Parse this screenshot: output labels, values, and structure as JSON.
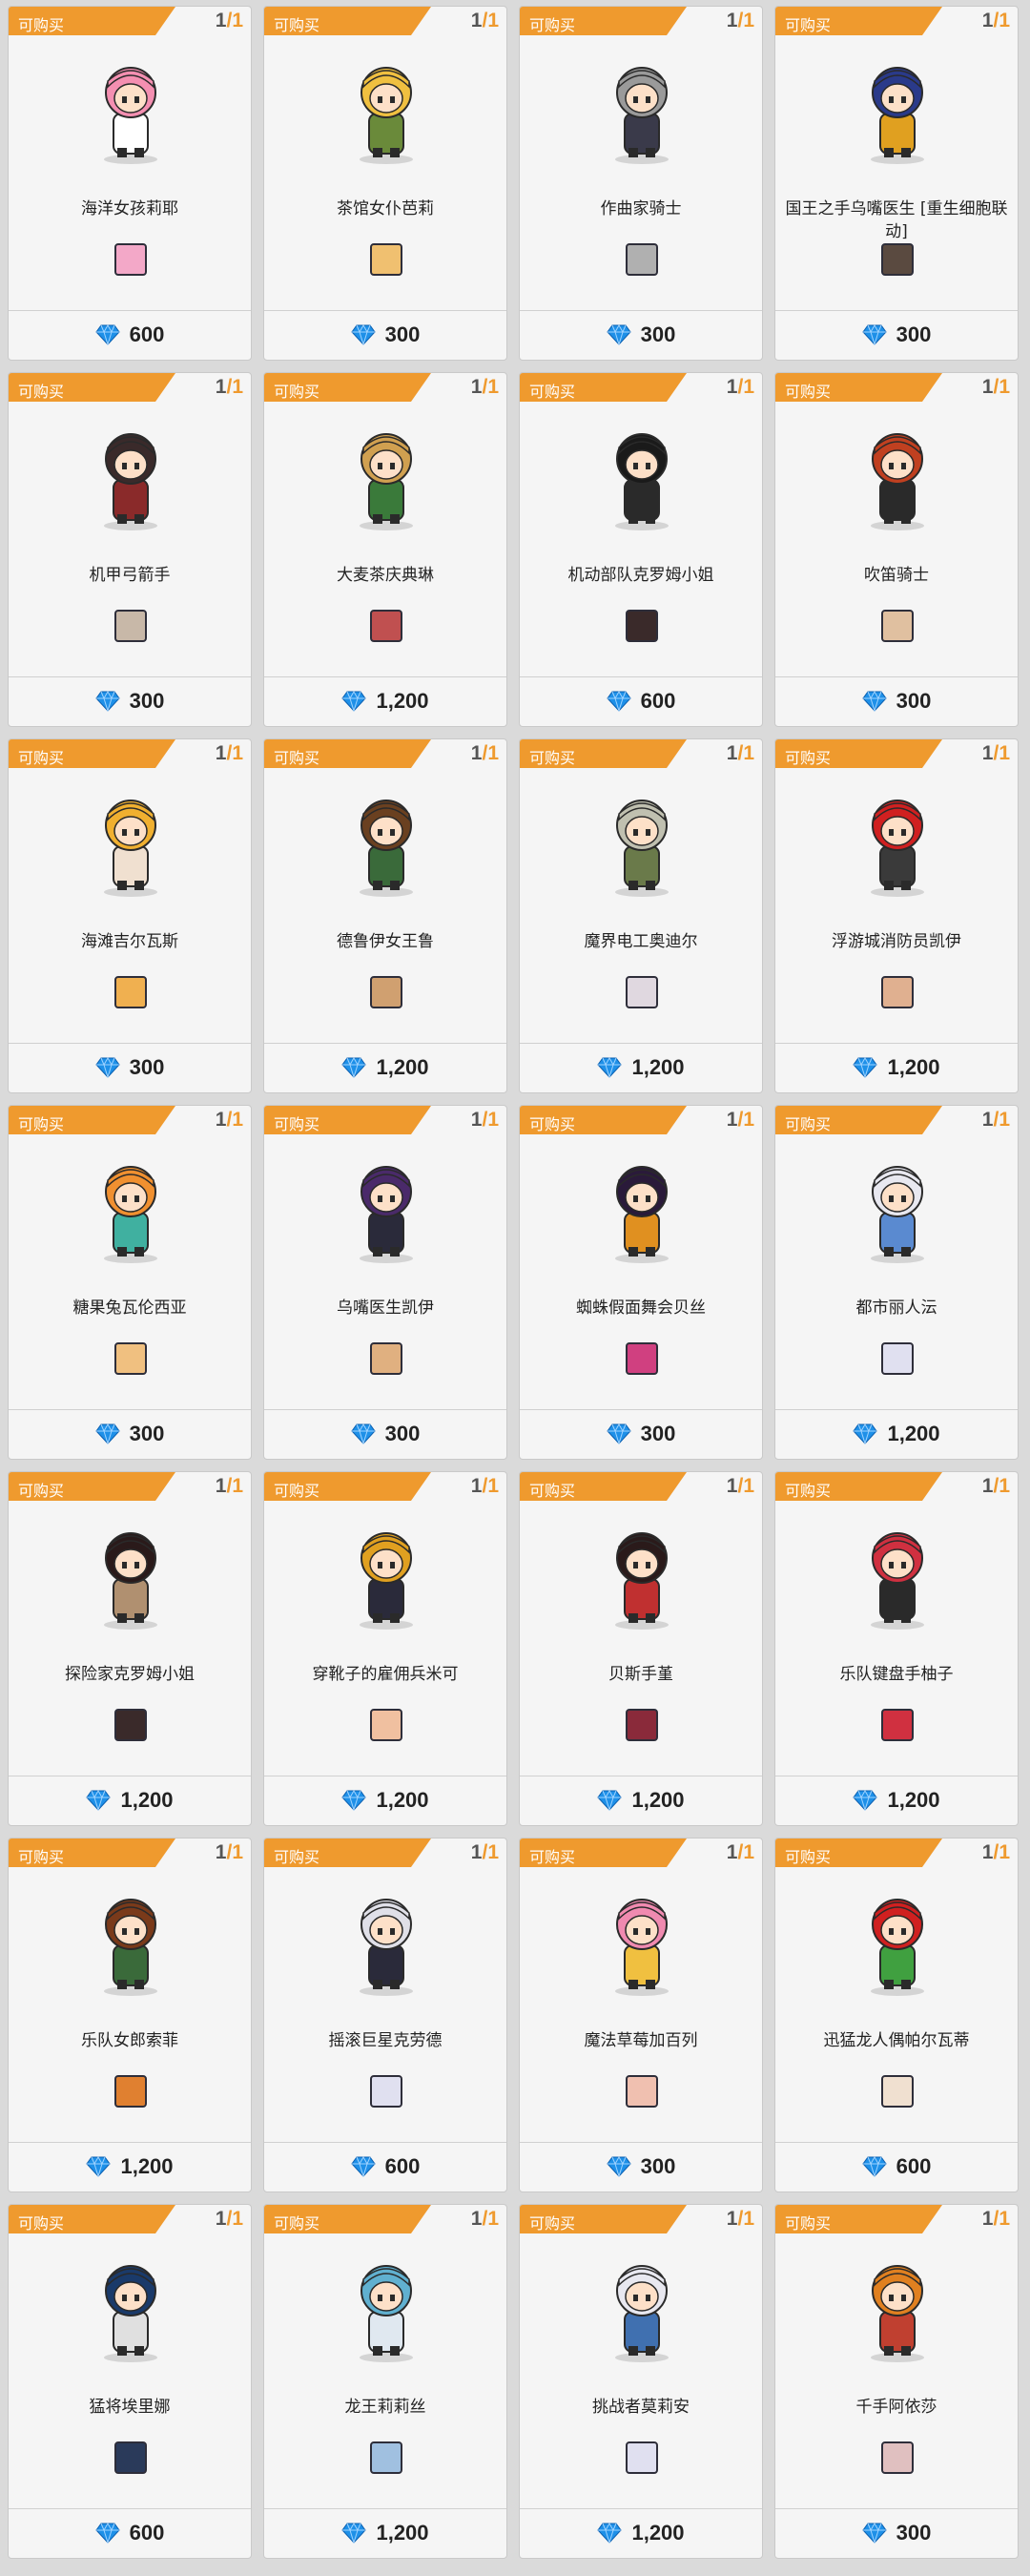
{
  "labels": {
    "badge": "可购买"
  },
  "colors": {
    "badge_bg": "#ef9a2e",
    "count_max": "#ef9a2e",
    "currency_gem": "#1e90e8"
  },
  "currency_icon": "blue-diamond-icon",
  "items": [
    {
      "name": "海洋女孩莉耶",
      "owned": "1",
      "limit": "1",
      "price": "600",
      "hair": "#f48fb1",
      "outfit": "#ffffff",
      "thumb": "#f3a8c8"
    },
    {
      "name": "茶馆女仆芭莉",
      "owned": "1",
      "limit": "1",
      "price": "300",
      "hair": "#f0c040",
      "outfit": "#6a8a3a",
      "thumb": "#f0c070"
    },
    {
      "name": "作曲家骑士",
      "owned": "1",
      "limit": "1",
      "price": "300",
      "hair": "#9a9a9a",
      "outfit": "#3a3a4a",
      "thumb": "#b0b0b0"
    },
    {
      "name": "国王之手乌嘴医生 [重生细胞联动]",
      "owned": "1",
      "limit": "1",
      "price": "300",
      "hair": "#2a3a8a",
      "outfit": "#e0a020",
      "thumb": "#5a4a40"
    },
    {
      "name": "机甲弓箭手",
      "owned": "1",
      "limit": "1",
      "price": "300",
      "hair": "#3a2a2a",
      "outfit": "#8a2a2a",
      "thumb": "#c8b8a8"
    },
    {
      "name": "大麦茶庆典琳",
      "owned": "1",
      "limit": "1",
      "price": "1,200",
      "hair": "#d0a050",
      "outfit": "#3a7a3a",
      "thumb": "#c05050"
    },
    {
      "name": "机动部队克罗姆小姐",
      "owned": "1",
      "limit": "1",
      "price": "600",
      "hair": "#1a1a1a",
      "outfit": "#2a2a2a",
      "thumb": "#3a2a2a"
    },
    {
      "name": "吹笛骑士",
      "owned": "1",
      "limit": "1",
      "price": "300",
      "hair": "#c04020",
      "outfit": "#2a2a2a",
      "thumb": "#e0c0a0"
    },
    {
      "name": "海滩吉尔瓦斯",
      "owned": "1",
      "limit": "1",
      "price": "300",
      "hair": "#f0b030",
      "outfit": "#f0e0d0",
      "thumb": "#f0b050"
    },
    {
      "name": "德鲁伊女王鲁",
      "owned": "1",
      "limit": "1",
      "price": "1,200",
      "hair": "#6a4020",
      "outfit": "#3a6a3a",
      "thumb": "#d0a070"
    },
    {
      "name": "魔界电工奥迪尔",
      "owned": "1",
      "limit": "1",
      "price": "1,200",
      "hair": "#c0c0b0",
      "outfit": "#6a7a4a",
      "thumb": "#e0d8e0"
    },
    {
      "name": "浮游城消防员凯伊",
      "owned": "1",
      "limit": "1",
      "price": "1,200",
      "hair": "#d02020",
      "outfit": "#3a3a3a",
      "thumb": "#e0b090"
    },
    {
      "name": "糖果兔瓦伦西亚",
      "owned": "1",
      "limit": "1",
      "price": "300",
      "hair": "#f09030",
      "outfit": "#40b0a0",
      "thumb": "#f0c080"
    },
    {
      "name": "乌嘴医生凯伊",
      "owned": "1",
      "limit": "1",
      "price": "300",
      "hair": "#4a2a6a",
      "outfit": "#2a2a3a",
      "thumb": "#e0b080"
    },
    {
      "name": "蜘蛛假面舞会贝丝",
      "owned": "1",
      "limit": "1",
      "price": "300",
      "hair": "#2a1a3a",
      "outfit": "#e09020",
      "thumb": "#d04080"
    },
    {
      "name": "都市丽人沄",
      "owned": "1",
      "limit": "1",
      "price": "1,200",
      "hair": "#e8e8f0",
      "outfit": "#5a8ad0",
      "thumb": "#e0e0f0"
    },
    {
      "name": "探险家克罗姆小姐",
      "owned": "1",
      "limit": "1",
      "price": "1,200",
      "hair": "#2a1a1a",
      "outfit": "#b09070",
      "thumb": "#3a2a2a"
    },
    {
      "name": "穿靴子的雇佣兵米可",
      "owned": "1",
      "limit": "1",
      "price": "1,200",
      "hair": "#e0a020",
      "outfit": "#2a2a3a",
      "thumb": "#f0c0a0"
    },
    {
      "name": "贝斯手堇",
      "owned": "1",
      "limit": "1",
      "price": "1,200",
      "hair": "#2a1a1a",
      "outfit": "#c03030",
      "thumb": "#8a2a3a"
    },
    {
      "name": "乐队键盘手柚子",
      "owned": "1",
      "limit": "1",
      "price": "1,200",
      "hair": "#d03040",
      "outfit": "#2a2a2a",
      "thumb": "#d03040"
    },
    {
      "name": "乐队女郎索菲",
      "owned": "1",
      "limit": "1",
      "price": "1,200",
      "hair": "#7a3a1a",
      "outfit": "#3a6a3a",
      "thumb": "#e08030"
    },
    {
      "name": "摇滚巨星克劳德",
      "owned": "1",
      "limit": "1",
      "price": "600",
      "hair": "#e0e0e8",
      "outfit": "#2a2a3a",
      "thumb": "#e0e0f0"
    },
    {
      "name": "魔法草莓加百列",
      "owned": "1",
      "limit": "1",
      "price": "300",
      "hair": "#f08ab0",
      "outfit": "#f0c040",
      "thumb": "#f0c0b0"
    },
    {
      "name": "迅猛龙人偶帕尔瓦蒂",
      "owned": "1",
      "limit": "1",
      "price": "600",
      "hair": "#d02020",
      "outfit": "#40a040",
      "thumb": "#f0e0d0"
    },
    {
      "name": "猛将埃里娜",
      "owned": "1",
      "limit": "1",
      "price": "600",
      "hair": "#1a3a6a",
      "outfit": "#e0e0e0",
      "thumb": "#2a3a5a"
    },
    {
      "name": "龙王莉莉丝",
      "owned": "1",
      "limit": "1",
      "price": "1,200",
      "hair": "#60b0d0",
      "outfit": "#e0e8f0",
      "thumb": "#a0c0e0"
    },
    {
      "name": "挑战者莫莉安",
      "owned": "1",
      "limit": "1",
      "price": "1,200",
      "hair": "#e8e8f0",
      "outfit": "#4070b0",
      "thumb": "#e0e0f0"
    },
    {
      "name": "千手阿依莎",
      "owned": "1",
      "limit": "1",
      "price": "300",
      "hair": "#e08020",
      "outfit": "#c04030",
      "thumb": "#e0c0c0"
    }
  ]
}
